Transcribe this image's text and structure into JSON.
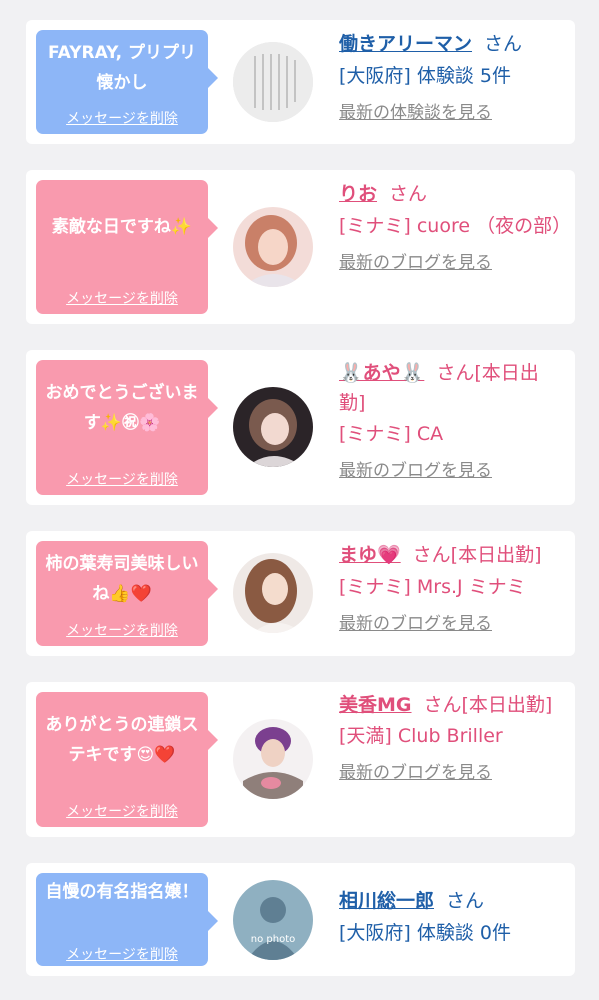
{
  "cards": [
    {
      "message": "FAYRAY, プリプリ懐かし",
      "delete_label": "メッセージを削除",
      "name": "働きアリーマン",
      "honorific": "さん",
      "meta": "[大阪府] 体験談 5件",
      "link": "最新の体験談を見る"
    },
    {
      "message": "素敵な日ですね✨",
      "delete_label": "メッセージを削除",
      "name": "りお",
      "honorific": "さん",
      "meta": "[ミナミ] cuore （夜の部）",
      "link": "最新のブログを見る"
    },
    {
      "message": "おめでとうございます✨㊗🌸",
      "delete_label": "メッセージを削除",
      "name": "🐰あや🐰",
      "honorific": "さん[本日出勤]",
      "meta": "[ミナミ] CA",
      "link": "最新のブログを見る"
    },
    {
      "message": "柿の葉寿司美味しいね👍❤️",
      "delete_label": "メッセージを削除",
      "name": "まゆ💗",
      "honorific": "さん[本日出勤]",
      "meta": "[ミナミ] Mrs.J ミナミ",
      "link": "最新のブログを見る"
    },
    {
      "message": "ありがとうの連鎖ステキです😍❤️",
      "delete_label": "メッセージを削除",
      "name": "美香MG",
      "honorific": "さん[本日出勤]",
      "meta": "[天満] Club Briller",
      "link": "最新のブログを見る"
    },
    {
      "message": "自慢の有名指名嬢！",
      "delete_label": "メッセージを削除",
      "name": "相川総一郎",
      "honorific": "さん",
      "meta": "[大阪府] 体験談 0件",
      "avatar_text": "no photo"
    }
  ],
  "colors": {
    "blue_bubble": "#8db6f7",
    "pink_bubble": "#f99aae",
    "blue_text": "#1f5fa8",
    "pink_text": "#e04f7b",
    "link_gray": "#8a8a8a"
  }
}
